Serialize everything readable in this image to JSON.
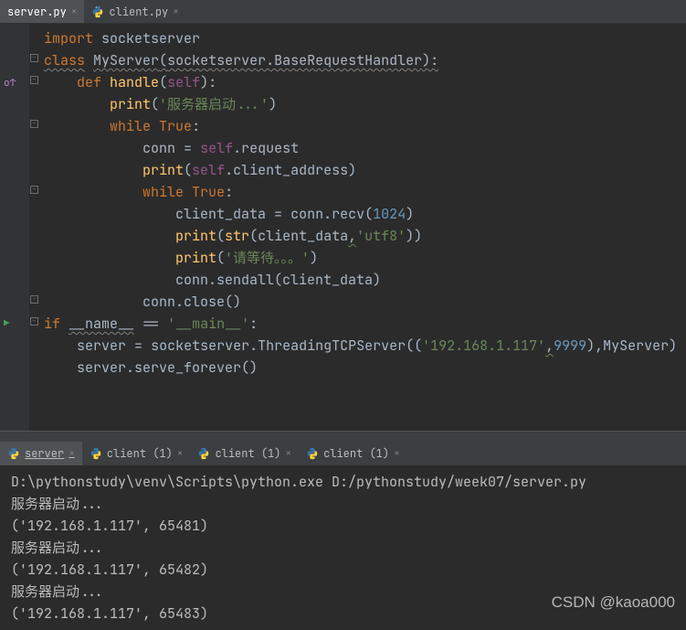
{
  "editor_tabs": [
    {
      "label": "server.py",
      "active": true
    },
    {
      "label": "client.py",
      "active": false
    }
  ],
  "code": {
    "l1": {
      "kw": "import",
      "mod": "socketserver"
    },
    "l2": {
      "kw": "class",
      "name": "MyServer",
      "base": "socketserver.BaseRequestHandler"
    },
    "l3": {
      "kw": "def",
      "fn": "handle",
      "arg": "self"
    },
    "l4": {
      "fn": "print",
      "str": "'服务器启动...'"
    },
    "l5": {
      "kw": "while",
      "val": "True"
    },
    "l6": {
      "var": "conn",
      "eq": "=",
      "self": "self",
      "attr": ".request"
    },
    "l7": {
      "fn": "print",
      "self": "self",
      "attr": ".client_address"
    },
    "l8": {
      "kw": "while",
      "val": "True"
    },
    "l9": {
      "var": "client_data",
      "eq": "=",
      "expr": "conn.recv(",
      "num": "1024",
      "close": ")"
    },
    "l10": {
      "fn": "print",
      "open": "(",
      "str_fn": "str",
      "arg": "client_data",
      "comma": ",",
      "str": "'utf8'",
      "close": "))"
    },
    "l11": {
      "fn": "print",
      "str": "'请等待。。。'"
    },
    "l12": {
      "expr": "conn.sendall(client_data)"
    },
    "l13": {
      "expr": "conn.close()"
    },
    "l14": {
      "kw": "if",
      "name": "__name__",
      "eq": "==",
      "str": "'__main__'"
    },
    "l15": {
      "var": "server",
      "eq": "=",
      "call": "socketserver.ThreadingTCPServer((",
      "ip": "'192.168.1.117'",
      "comma": ",",
      "port": "9999",
      "close": "),",
      "cls": "MyServer",
      "end": ")"
    },
    "l16": {
      "expr": "server.serve_forever()"
    }
  },
  "console_tabs": [
    {
      "label": "server",
      "active": true
    },
    {
      "label": "client (1)",
      "active": false
    },
    {
      "label": "client (1)",
      "active": false
    },
    {
      "label": "client (1)",
      "active": false
    }
  ],
  "console": {
    "l1": "D:\\pythonstudy\\venv\\Scripts\\python.exe D:/pythonstudy/week07/server.py",
    "l2": "服务器启动...",
    "l3": "('192.168.1.117', 65481)",
    "l4": "服务器启动...",
    "l5": "('192.168.1.117', 65482)",
    "l6": "服务器启动...",
    "l7": "('192.168.1.117', 65483)"
  },
  "watermark": "CSDN @kaoa000"
}
